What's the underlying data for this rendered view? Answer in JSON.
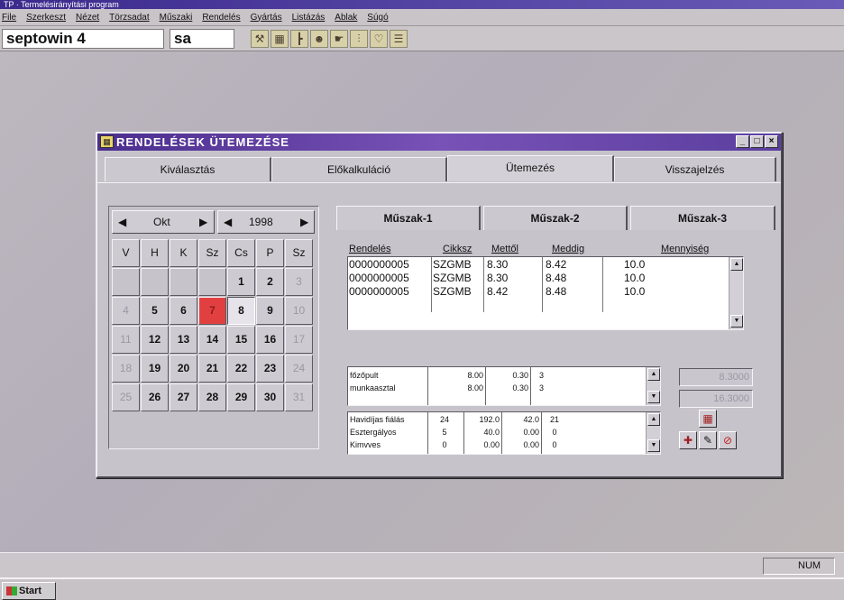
{
  "app": {
    "title": "TP · Termelésirányítási program",
    "menu": [
      "File",
      "Szerkeszt",
      "Nézet",
      "Törzsadat",
      "Műszaki",
      "Rendelés",
      "Gyártás",
      "Listázás",
      "Ablak",
      "Súgó"
    ]
  },
  "toolbar": {
    "field1": "septowin 4",
    "field2": "sa",
    "icons": [
      "hammer-icon",
      "grid-icon",
      "tree-icon",
      "users-icon",
      "hand-icon",
      "graph-icon",
      "heart-icon",
      "stack-icon"
    ]
  },
  "dialog": {
    "title": "RENDELÉSEK ÜTEMEZÉSE",
    "tabs": [
      "Kiválasztás",
      "Előkalkuláció",
      "Ütemezés",
      "Visszajelzés"
    ],
    "active_tab": "Ütemezés",
    "window_buttons": [
      "_",
      "□",
      "×"
    ]
  },
  "calendar": {
    "prev": "◀",
    "next": "▶",
    "month": "Okt",
    "year_prev": "◀",
    "year": "1998",
    "year_next": "▶",
    "weekdays": [
      "V",
      "H",
      "K",
      "Sz",
      "Cs",
      "P",
      "Sz"
    ],
    "weeks": [
      [
        "",
        "",
        "",
        "",
        "1",
        "2",
        "3"
      ],
      [
        "4",
        "5",
        "6",
        "7",
        "8",
        "9",
        "10"
      ],
      [
        "11",
        "12",
        "13",
        "14",
        "15",
        "16",
        "17"
      ],
      [
        "18",
        "19",
        "20",
        "21",
        "22",
        "23",
        "24"
      ],
      [
        "25",
        "26",
        "27",
        "28",
        "29",
        "30",
        "31"
      ]
    ],
    "today": "7",
    "selected": "8"
  },
  "shifts": {
    "tabs": [
      "Műszak-1",
      "Műszak-2",
      "Műszak-3"
    ],
    "active": "Műszak-1"
  },
  "orders": {
    "headers": [
      "Rendelés",
      "Cikksz",
      "Mettől",
      "Meddig",
      "Mennyiség"
    ],
    "rows": [
      [
        "0000000005",
        "SZGMB",
        "8.30",
        "8.42",
        "10.0"
      ],
      [
        "0000000005",
        "SZGMB",
        "8.30",
        "8.48",
        "10.0"
      ],
      [
        "0000000005",
        "SZGMB",
        "8.42",
        "8.48",
        "10.0"
      ]
    ]
  },
  "machines": {
    "rows": [
      [
        "főzőpult",
        "8.00",
        "0.30",
        "3"
      ],
      [
        "munkaasztal",
        "8.00",
        "0.30",
        "3"
      ]
    ],
    "field1": "8.3000",
    "field2": "16.3000"
  },
  "workers": {
    "rows": [
      [
        "Havidíjas fiálás",
        "24",
        "192.0",
        "42.0",
        "21"
      ],
      [
        "Esztergályos",
        "5",
        "40.0",
        "0.00",
        "0"
      ],
      [
        "Kimvves",
        "0",
        "0.00",
        "0.00",
        "0"
      ]
    ]
  },
  "status": {
    "num": "NUM"
  },
  "taskbar": {
    "start": "Start"
  }
}
